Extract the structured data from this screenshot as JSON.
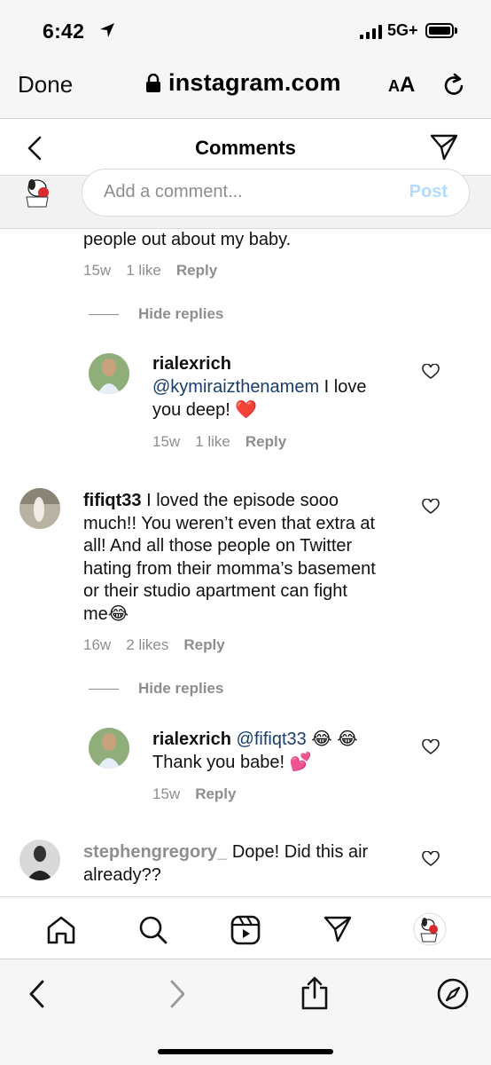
{
  "status_bar": {
    "time": "6:42",
    "network": "5G+"
  },
  "browser": {
    "done_label": "Done",
    "url": "instagram.com",
    "aa_label": "A",
    "aa_label_big": "A"
  },
  "header": {
    "title": "Comments"
  },
  "compose": {
    "placeholder": "Add a comment...",
    "post_label": "Post"
  },
  "comments": {
    "c0": {
      "text": "people out about my baby.",
      "time": "15w",
      "likes": "1 like",
      "reply": "Reply"
    },
    "hide_replies_1": "Hide replies",
    "r1": {
      "username": "rialexrich",
      "mention": "@kymiraizthenamem",
      "text_line1_rest": " I love",
      "text_line2": "you deep! ❤️",
      "time": "15w",
      "likes": "1 like",
      "reply": "Reply"
    },
    "c2": {
      "username": "fifiqt33",
      "line1_rest": " I loved the episode sooo",
      "line2": "much!! You weren’t even that extra at",
      "line3": "all! And all those people on Twitter",
      "line4": "hating from their momma’s basement",
      "line5": "or their studio apartment can fight",
      "line6": "me😂",
      "time": "16w",
      "likes": "2 likes",
      "reply": "Reply"
    },
    "hide_replies_2": "Hide replies",
    "r2": {
      "username": "rialexrich",
      "mention": "@fifiqt33",
      "line1_rest": " 😂 😂",
      "line2": "Thank you babe! 💕",
      "time": "15w",
      "reply": "Reply"
    },
    "c3": {
      "username": "stephengregory_",
      "line1_rest": " Dope! Did this air",
      "line2": "already??"
    }
  },
  "icons": {
    "status": [
      "location-arrow-icon",
      "signal-icon",
      "battery-icon"
    ],
    "browser": [
      "lock-icon",
      "reload-icon"
    ],
    "header": [
      "back-icon",
      "send-icon"
    ],
    "nav": [
      "home-icon",
      "search-icon",
      "reels-icon",
      "direct-icon",
      "profile-avatar"
    ],
    "safari": [
      "back-icon",
      "forward-icon",
      "share-icon",
      "compass-icon"
    ]
  },
  "colors": {
    "mention": "#1a3d6b",
    "post_disabled": "#b3dbff",
    "muted": "#8e8e8e"
  }
}
